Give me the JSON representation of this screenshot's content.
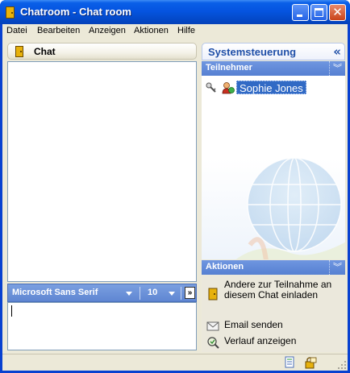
{
  "window": {
    "title": "Chatroom - Chat room"
  },
  "menu": [
    "Datei",
    "Bearbeiten",
    "Anzeigen",
    "Aktionen",
    "Hilfe"
  ],
  "chat": {
    "header": "Chat",
    "font_name": "Microsoft Sans Serif",
    "font_size": "10",
    "more_label": "»",
    "input_value": ""
  },
  "system_panel": {
    "title": "Systemsteuerung",
    "collapse_glyph": "«",
    "participants_title": "Teilnehmer",
    "participants": [
      {
        "name": "Sophie Jones"
      }
    ],
    "actions_title": "Aktionen",
    "actions": [
      {
        "label": "Andere zur Teilnahme an diesem Chat einladen",
        "icon": "door-icon"
      },
      {
        "label": "Email senden",
        "icon": "email-icon"
      },
      {
        "label": "Verlauf anzeigen",
        "icon": "history-icon"
      }
    ]
  },
  "colors": {
    "title_bar": "#0554e0",
    "panel_header": "#5f86d2",
    "selection": "#316ac5",
    "accent_text": "#1f4fa8"
  }
}
